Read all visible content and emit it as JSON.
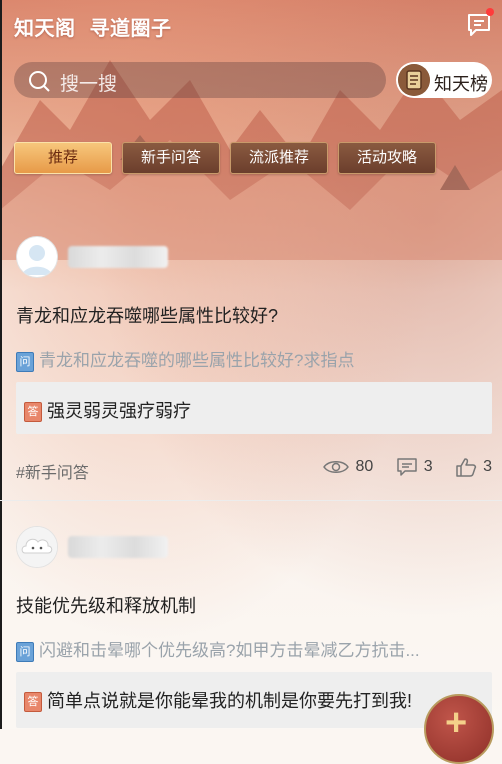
{
  "header": {
    "brand": "知天阁",
    "subtitle": "寻道圈子",
    "message_icon": "message-icon"
  },
  "search": {
    "placeholder": "搜一搜",
    "icon": "search-icon"
  },
  "ranking": {
    "label": "知天榜",
    "icon": "scroll-icon"
  },
  "tabs": [
    {
      "label": "推荐",
      "active": true
    },
    {
      "label": "新手问答",
      "active": false
    },
    {
      "label": "流派推荐",
      "active": false
    },
    {
      "label": "活动攻略",
      "active": false
    }
  ],
  "posts": [
    {
      "title": "青龙和应龙吞噬哪些属性比较好?",
      "question": "青龙和应龙吞噬的哪些属性比较好?求指点",
      "answer": "强灵弱灵强疗弱疗",
      "tag": "#新手问答",
      "views": "80",
      "comments": "3",
      "likes": "3"
    },
    {
      "title": "技能优先级和释放机制",
      "question": "闪避和击晕哪个优先级高?如甲方击晕减乙方抗击...",
      "answer": "简单点说就是你能晕我的机制是你要先打到我!"
    }
  ],
  "icons": {
    "question_badge": "问",
    "answer_badge": "答"
  },
  "fab": {
    "label": "+"
  },
  "colors": {
    "tab_active": "#e79a48",
    "tab_inactive": "#6b3e2c",
    "notification_dot": "#ff3b3b"
  }
}
